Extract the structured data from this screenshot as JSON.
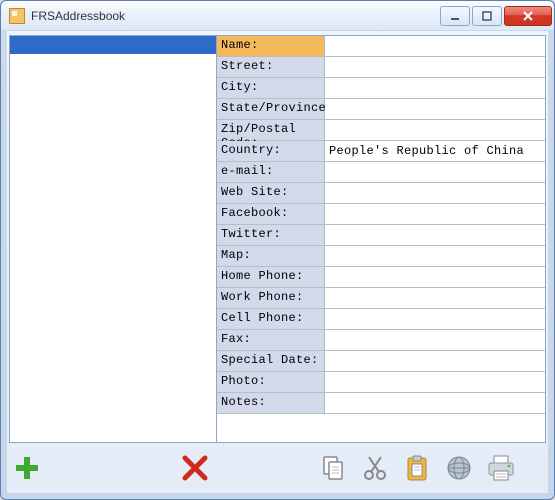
{
  "window": {
    "title": "FRSAddressbook"
  },
  "list": {
    "items": [
      {
        "label": "",
        "selected": true
      }
    ]
  },
  "fields": [
    {
      "label": "Name:",
      "value": "",
      "active": true
    },
    {
      "label": "Street:",
      "value": ""
    },
    {
      "label": "City:",
      "value": ""
    },
    {
      "label": "State/Province:",
      "value": ""
    },
    {
      "label": "Zip/Postal Code:",
      "value": ""
    },
    {
      "label": "Country:",
      "value": "People's Republic of China"
    },
    {
      "label": "e-mail:",
      "value": ""
    },
    {
      "label": "Web Site:",
      "value": ""
    },
    {
      "label": "Facebook:",
      "value": ""
    },
    {
      "label": "Twitter:",
      "value": ""
    },
    {
      "label": "Map:",
      "value": ""
    },
    {
      "label": "Home Phone:",
      "value": ""
    },
    {
      "label": "Work Phone:",
      "value": ""
    },
    {
      "label": "Cell Phone:",
      "value": ""
    },
    {
      "label": "Fax:",
      "value": ""
    },
    {
      "label": "Special Date:",
      "value": ""
    },
    {
      "label": "Photo:",
      "value": ""
    },
    {
      "label": "Notes:",
      "value": ""
    }
  ],
  "toolbar": {
    "add": "Add",
    "delete": "Delete",
    "copy": "Copy",
    "cut": "Cut",
    "paste": "Paste",
    "globe": "Web",
    "print": "Print"
  }
}
